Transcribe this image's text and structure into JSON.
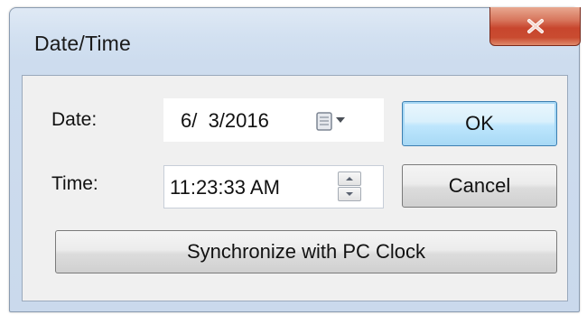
{
  "window": {
    "title": "Date/Time",
    "close_icon": "close-icon"
  },
  "date": {
    "label": "Date:",
    "value": "6/  3/2016",
    "picker_icon": "calendar-dropdown-icon"
  },
  "time": {
    "label": "Time:",
    "value": "11:23:33 AM",
    "spinner_icon": "spin-updown-icon"
  },
  "buttons": {
    "ok_label": "OK",
    "cancel_label": "Cancel",
    "sync_label": "Synchronize with PC Clock"
  },
  "colors": {
    "close_button": "#c8462e",
    "default_button_border": "#3c7fb1"
  }
}
